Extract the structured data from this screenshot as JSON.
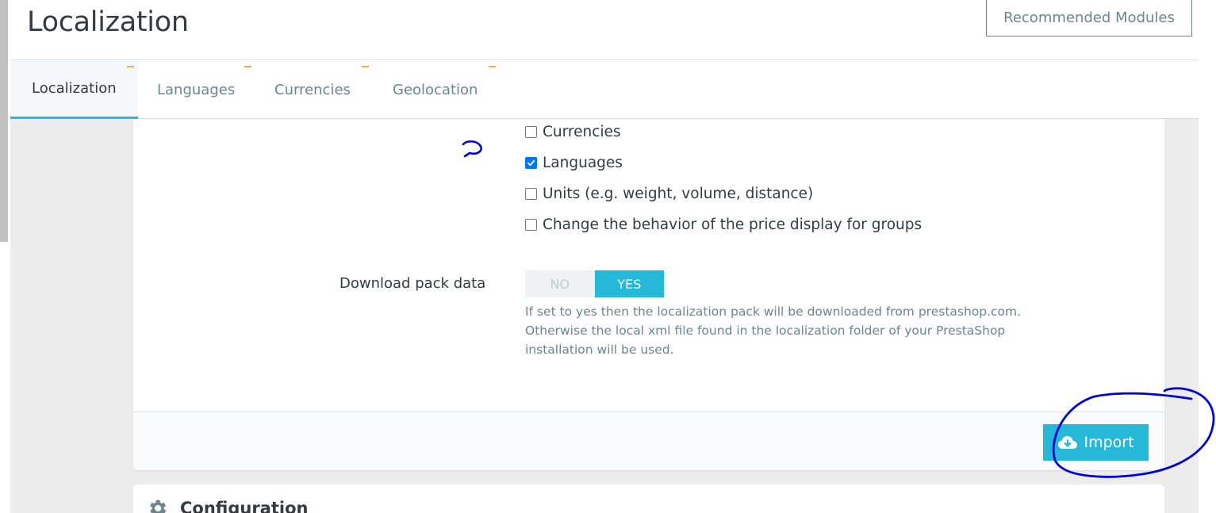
{
  "header": {
    "title": "Localization",
    "recommended_button": "Recommended Modules"
  },
  "tabs": [
    {
      "label": "Localization",
      "active": true
    },
    {
      "label": "Languages",
      "active": false
    },
    {
      "label": "Currencies",
      "active": false
    },
    {
      "label": "Geolocation",
      "active": false
    }
  ],
  "import_options": [
    {
      "label": "Currencies",
      "checked": false
    },
    {
      "label": "Languages",
      "checked": true
    },
    {
      "label": "Units (e.g. weight, volume, distance)",
      "checked": false
    },
    {
      "label": "Change the behavior of the price display for groups",
      "checked": false
    }
  ],
  "download_pack": {
    "label": "Download pack data",
    "no_label": "NO",
    "yes_label": "YES",
    "selected": "YES",
    "help": "If set to yes then the localization pack will be downloaded from prestashop.com. Otherwise the local xml file found in the localization folder of your PrestaShop installation will be used."
  },
  "footer": {
    "import_button": "Import"
  },
  "configuration_panel": {
    "title": "Configuration"
  },
  "colors": {
    "accent": "#25b9d7",
    "annotation": "#0000dd"
  },
  "icons": [
    "cloud-download-icon",
    "gear-icon",
    "check-icon"
  ]
}
